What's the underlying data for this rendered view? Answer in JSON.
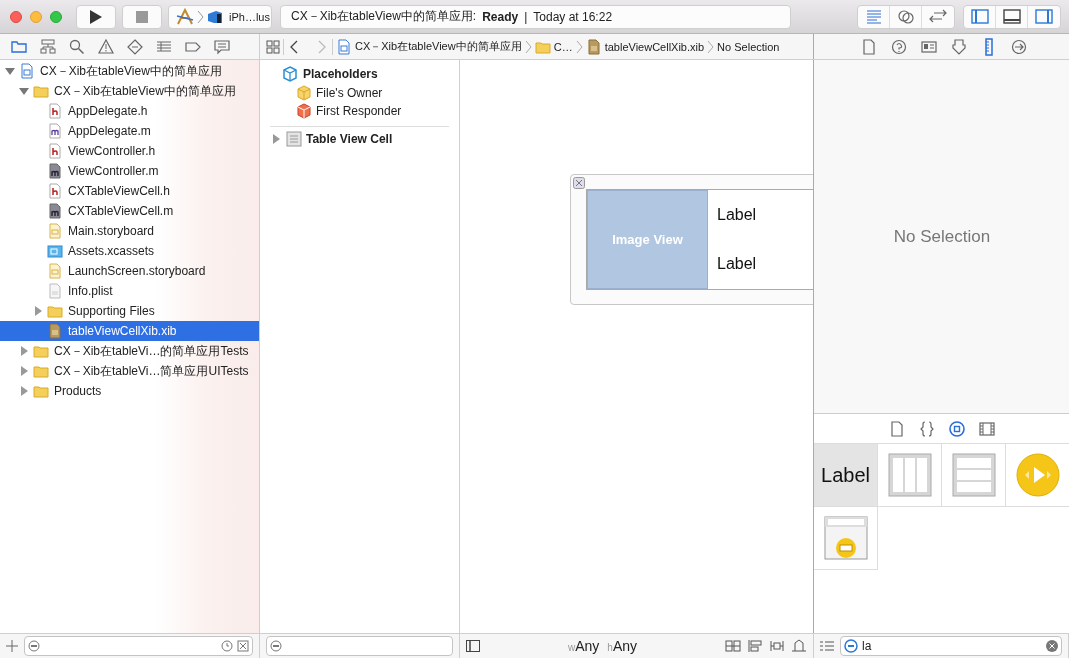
{
  "toolbar": {
    "scheme": {
      "device": "iPh…lus"
    },
    "activity": {
      "project": "CX－Xib在tableView中的简单应用:",
      "status": "Ready",
      "separator": "|",
      "time": "Today at 16:22"
    },
    "editor_modes": [
      {
        "kind": "standard",
        "selected": true
      },
      {
        "kind": "assistant",
        "selected": false
      },
      {
        "kind": "version",
        "selected": false
      }
    ],
    "view_toggles": [
      {
        "kind": "left",
        "on": true
      },
      {
        "kind": "bottom",
        "on": false
      },
      {
        "kind": "right",
        "on": true
      }
    ]
  },
  "navigator": {
    "tabs": [
      {
        "kind": "folder",
        "selected": true
      },
      {
        "kind": "hierarchy",
        "selected": false
      },
      {
        "kind": "search",
        "selected": false
      },
      {
        "kind": "warning",
        "selected": false
      },
      {
        "kind": "diamond",
        "selected": false
      },
      {
        "kind": "list",
        "selected": false
      },
      {
        "kind": "tag",
        "selected": false
      },
      {
        "kind": "speech",
        "selected": false
      }
    ],
    "tree": [
      {
        "kind": "project",
        "name": "CX－Xib在tableView中的简单应用",
        "expanded": true,
        "selected": false,
        "children": [
          {
            "kind": "folder",
            "name": "CX－Xib在tableView中的简单应用",
            "expanded": true,
            "selected": false,
            "children": [
              {
                "kind": "h",
                "name": "AppDelegate.h",
                "selected": false
              },
              {
                "kind": "m",
                "name": "AppDelegate.m",
                "selected": false
              },
              {
                "kind": "h",
                "name": "ViewController.h",
                "selected": false
              },
              {
                "kind": "m-dark",
                "name": "ViewController.m",
                "selected": false
              },
              {
                "kind": "h",
                "name": "CXTableViewCell.h",
                "selected": false
              },
              {
                "kind": "m-dark",
                "name": "CXTableViewCell.m",
                "selected": false
              },
              {
                "kind": "storyboard",
                "name": "Main.storyboard",
                "selected": false
              },
              {
                "kind": "assets",
                "name": "Assets.xcassets",
                "selected": false
              },
              {
                "kind": "storyboard",
                "name": "LaunchScreen.storyboard",
                "selected": false
              },
              {
                "kind": "plist",
                "name": "Info.plist",
                "selected": false
              },
              {
                "kind": "folder",
                "name": "Supporting Files",
                "expanded": false,
                "selected": false
              },
              {
                "kind": "xib",
                "name": "tableViewCellXib.xib",
                "selected": true
              }
            ]
          },
          {
            "kind": "folder",
            "name": "CX－Xib在tableVi…的简单应用Tests",
            "expanded": false,
            "selected": false
          },
          {
            "kind": "folder",
            "name": "CX－Xib在tableVi…简单应用UITests",
            "expanded": false,
            "selected": false
          },
          {
            "kind": "folder",
            "name": "Products",
            "expanded": false,
            "selected": false
          }
        ]
      }
    ]
  },
  "jump_bar": {
    "path": [
      {
        "kind": "project",
        "text": "CX－Xib在tableView中的简单应用"
      },
      {
        "kind": "folder",
        "text": "C…"
      },
      {
        "kind": "xib",
        "text": "tableViewCellXib.xib"
      },
      {
        "kind": "none",
        "text": "No Selection"
      }
    ]
  },
  "outline": {
    "placeholders": {
      "title": "Placeholders",
      "items": [
        {
          "kind": "owner",
          "name": "File's Owner"
        },
        {
          "kind": "responder",
          "name": "First Responder"
        }
      ]
    },
    "objects": [
      {
        "name": "Table View Cell",
        "expanded": false
      }
    ]
  },
  "canvas": {
    "cell": {
      "image_view": "Image View",
      "labels": [
        "Label",
        "Label"
      ]
    },
    "size_class": [
      {
        "axis": "w",
        "value": "Any"
      },
      {
        "axis": "h",
        "value": "Any"
      }
    ]
  },
  "inspector": {
    "tabs": [
      {
        "kind": "file",
        "selected": false
      },
      {
        "kind": "help",
        "selected": false
      },
      {
        "kind": "identity",
        "selected": false
      },
      {
        "kind": "attributes",
        "selected": false
      },
      {
        "kind": "size",
        "selected": true
      },
      {
        "kind": "connections",
        "selected": false
      }
    ],
    "empty_message": "No Selection"
  },
  "library": {
    "tabs": [
      {
        "kind": "file",
        "selected": false
      },
      {
        "kind": "code",
        "selected": false
      },
      {
        "kind": "object",
        "selected": true
      },
      {
        "kind": "media",
        "selected": false
      }
    ],
    "items": [
      {
        "kind": "label",
        "text": "Label",
        "selected": true
      },
      {
        "kind": "columns",
        "selected": false
      },
      {
        "kind": "rows",
        "selected": false
      },
      {
        "kind": "player",
        "selected": false
      },
      {
        "kind": "search-display",
        "selected": false
      }
    ],
    "search": {
      "value": "la"
    }
  }
}
